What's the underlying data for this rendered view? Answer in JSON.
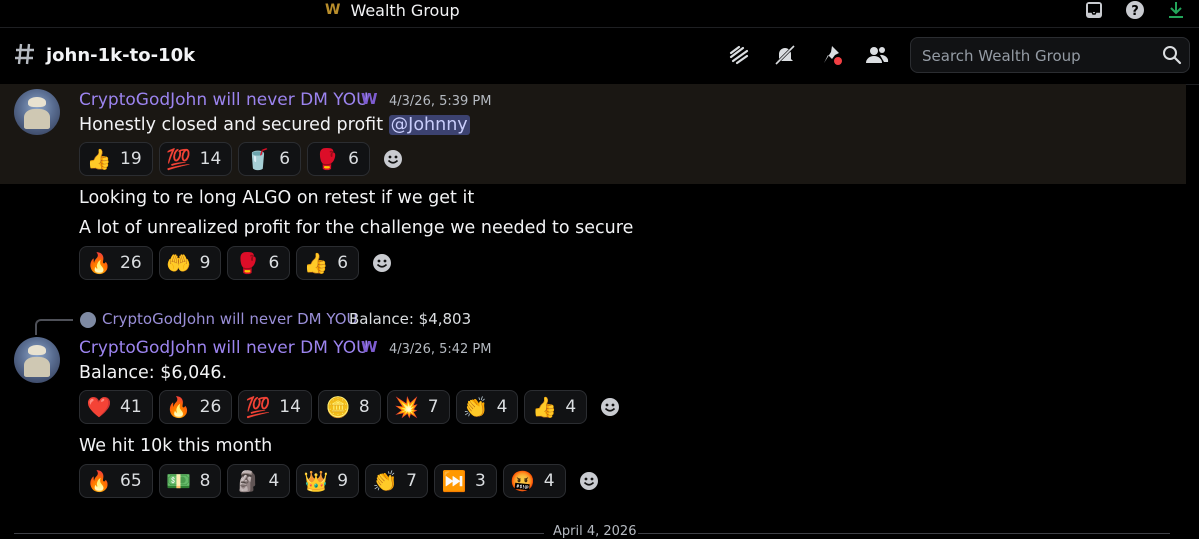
{
  "titlebar": {
    "app_name": "Wealth Group",
    "logo": "W"
  },
  "header": {
    "channel_name": "john-1k-to-10k",
    "search_placeholder": "Search Wealth Group",
    "icons": [
      "threads-icon",
      "mute-bell-icon",
      "pin-icon",
      "members-icon"
    ]
  },
  "messages": [
    {
      "author": "CryptoGodJohn will never DM YOU",
      "badge": "W",
      "timestamp": "4/3/26, 5:39 PM",
      "text_before": "Honestly closed and secured profit",
      "mention": "@Johnny",
      "reactions": [
        {
          "emoji": "👍",
          "count": "19"
        },
        {
          "emoji": "💯",
          "count": "14"
        },
        {
          "emoji": "🥤",
          "count": "6"
        },
        {
          "emoji": "🥊",
          "count": "6"
        }
      ]
    },
    {
      "lines": [
        "Looking to re long ALGO on retest if we get it",
        "A lot of unrealized profit for the challenge we needed to secure"
      ],
      "reactions": [
        {
          "emoji": "🔥",
          "count": "26"
        },
        {
          "emoji": "🤲",
          "count": "9"
        },
        {
          "emoji": "🥊",
          "count": "6"
        },
        {
          "emoji": "👍",
          "count": "6"
        }
      ]
    },
    {
      "reply": {
        "author": "CryptoGodJohn will never DM YOU",
        "text": "Balance: $4,803"
      },
      "author": "CryptoGodJohn will never DM YOU",
      "badge": "W",
      "timestamp": "4/3/26, 5:42 PM",
      "text": "Balance: $6,046.",
      "reactions": [
        {
          "emoji": "❤️",
          "count": "41"
        },
        {
          "emoji": "🔥",
          "count": "26"
        },
        {
          "emoji": "💯",
          "count": "14"
        },
        {
          "emoji": "🪙",
          "count": "8"
        },
        {
          "emoji": "💥",
          "count": "7"
        },
        {
          "emoji": "👏",
          "count": "4"
        },
        {
          "emoji": "👍",
          "count": "4"
        }
      ]
    },
    {
      "text": "We hit 10k this month",
      "reactions": [
        {
          "emoji": "🔥",
          "count": "65"
        },
        {
          "emoji": "💵",
          "count": "8"
        },
        {
          "emoji": "🗿",
          "count": "4"
        },
        {
          "emoji": "👑",
          "count": "9"
        },
        {
          "emoji": "👏",
          "count": "7"
        },
        {
          "emoji": "⏭️",
          "count": "3"
        },
        {
          "emoji": "🤬",
          "count": "4"
        }
      ]
    }
  ],
  "date_divider": "April 4, 2026"
}
